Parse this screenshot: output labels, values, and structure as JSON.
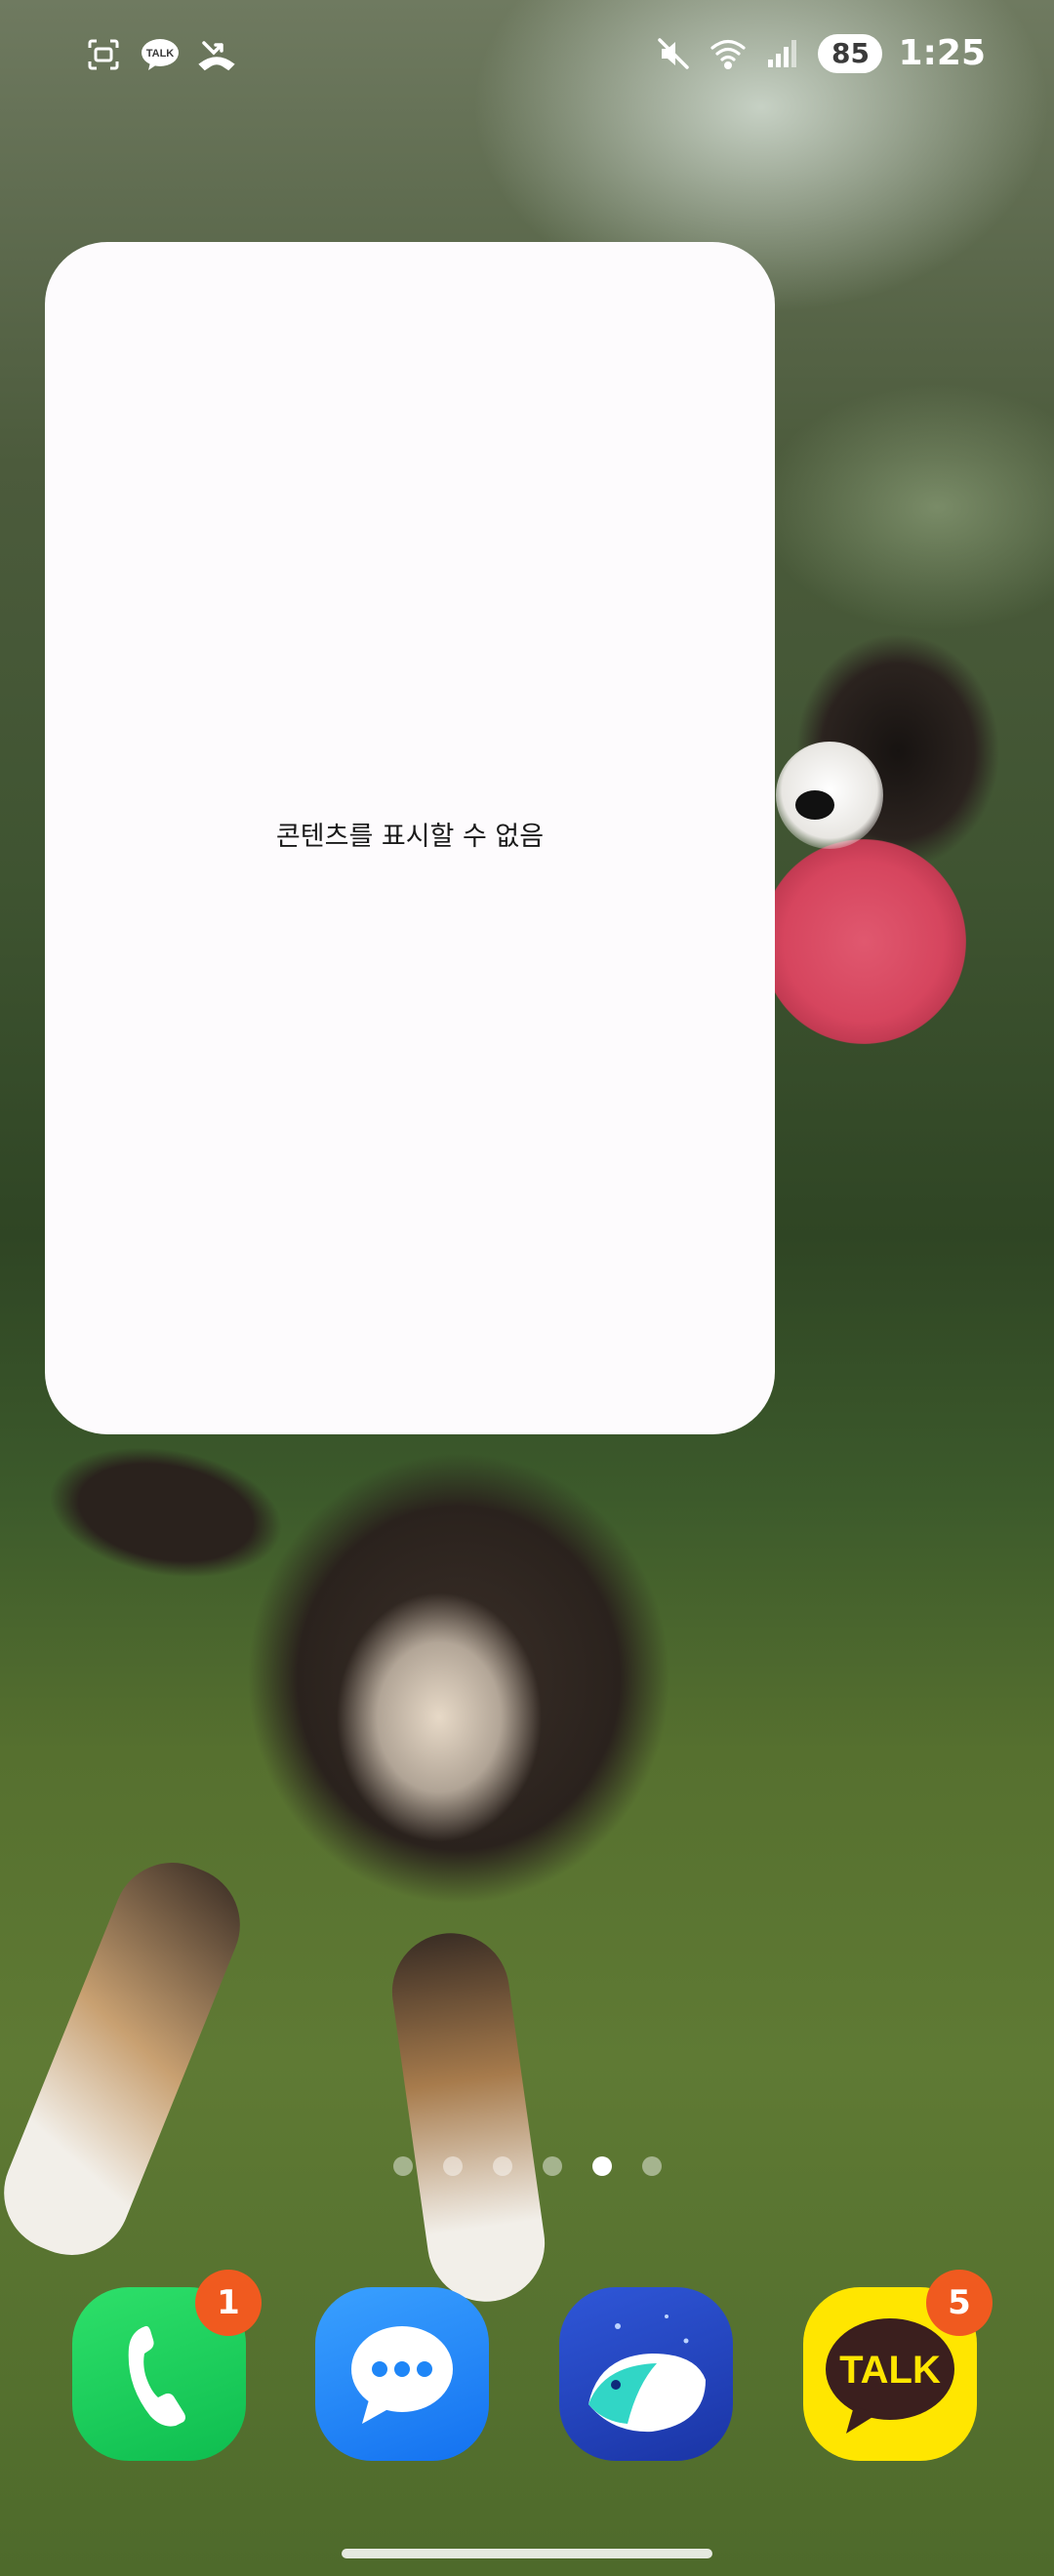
{
  "status_bar": {
    "left_icons": [
      "screenshot-icon",
      "kakaotalk-notification-icon",
      "missed-call-icon"
    ],
    "talk_text": "TALK",
    "right_icons": [
      "mute-icon",
      "wifi-icon",
      "signal-icon"
    ],
    "battery": "85",
    "time": "1:25"
  },
  "widget": {
    "message": "콘텐츠를 표시할 수 없음"
  },
  "page_indicator": {
    "count": 6,
    "active_index": 4
  },
  "dock": {
    "apps": [
      {
        "name": "phone",
        "icon": "phone-icon",
        "badge": "1"
      },
      {
        "name": "messages",
        "icon": "messages-icon",
        "badge": ""
      },
      {
        "name": "naver-whale",
        "icon": "whale-icon",
        "badge": ""
      },
      {
        "name": "kakaotalk",
        "icon": "kakaotalk-icon",
        "label": "TALK",
        "badge": "5"
      }
    ]
  },
  "colors": {
    "badge": "#f05a1f",
    "kakao_yellow": "#ffe600",
    "widget_bg": "#fdfbfd"
  }
}
